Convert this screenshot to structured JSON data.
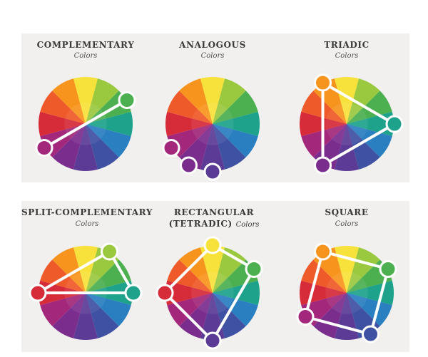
{
  "scheme_colors": [
    "#f7e23b",
    "#9ac93f",
    "#4caf50",
    "#1ea28b",
    "#2a7fc0",
    "#3f51a3",
    "#5b3b96",
    "#7b2d8e",
    "#a3287b",
    "#d62c3a",
    "#ef5a2a",
    "#f7941d"
  ],
  "diagrams": [
    {
      "title_line1": "COMPLEMENTARY",
      "title_line2": "",
      "subtitle": "Colors",
      "markers": [
        2,
        8
      ],
      "shape": "line"
    },
    {
      "title_line1": "ANALOGOUS",
      "title_line2": "",
      "subtitle": "Colors",
      "markers": [
        6,
        7,
        8
      ],
      "shape": "none"
    },
    {
      "title_line1": "TRIADIC",
      "title_line2": "",
      "subtitle": "Colors",
      "markers": [
        11,
        3,
        7
      ],
      "shape": "polygon"
    },
    {
      "title_line1": "SPLIT-COMPLEMENTARY",
      "title_line2": "",
      "subtitle": "Colors",
      "markers": [
        1,
        3,
        9
      ],
      "shape": "polygon"
    },
    {
      "title_line1": "RECTANGULAR",
      "title_line2": "(TETRADIC)",
      "subtitle": "Colors",
      "markers": [
        0,
        2,
        6,
        9
      ],
      "shape": "polygon"
    },
    {
      "title_line1": "SQUARE",
      "title_line2": "",
      "subtitle": "Colors",
      "markers": [
        11,
        2,
        5,
        8
      ],
      "shape": "polygon"
    }
  ]
}
